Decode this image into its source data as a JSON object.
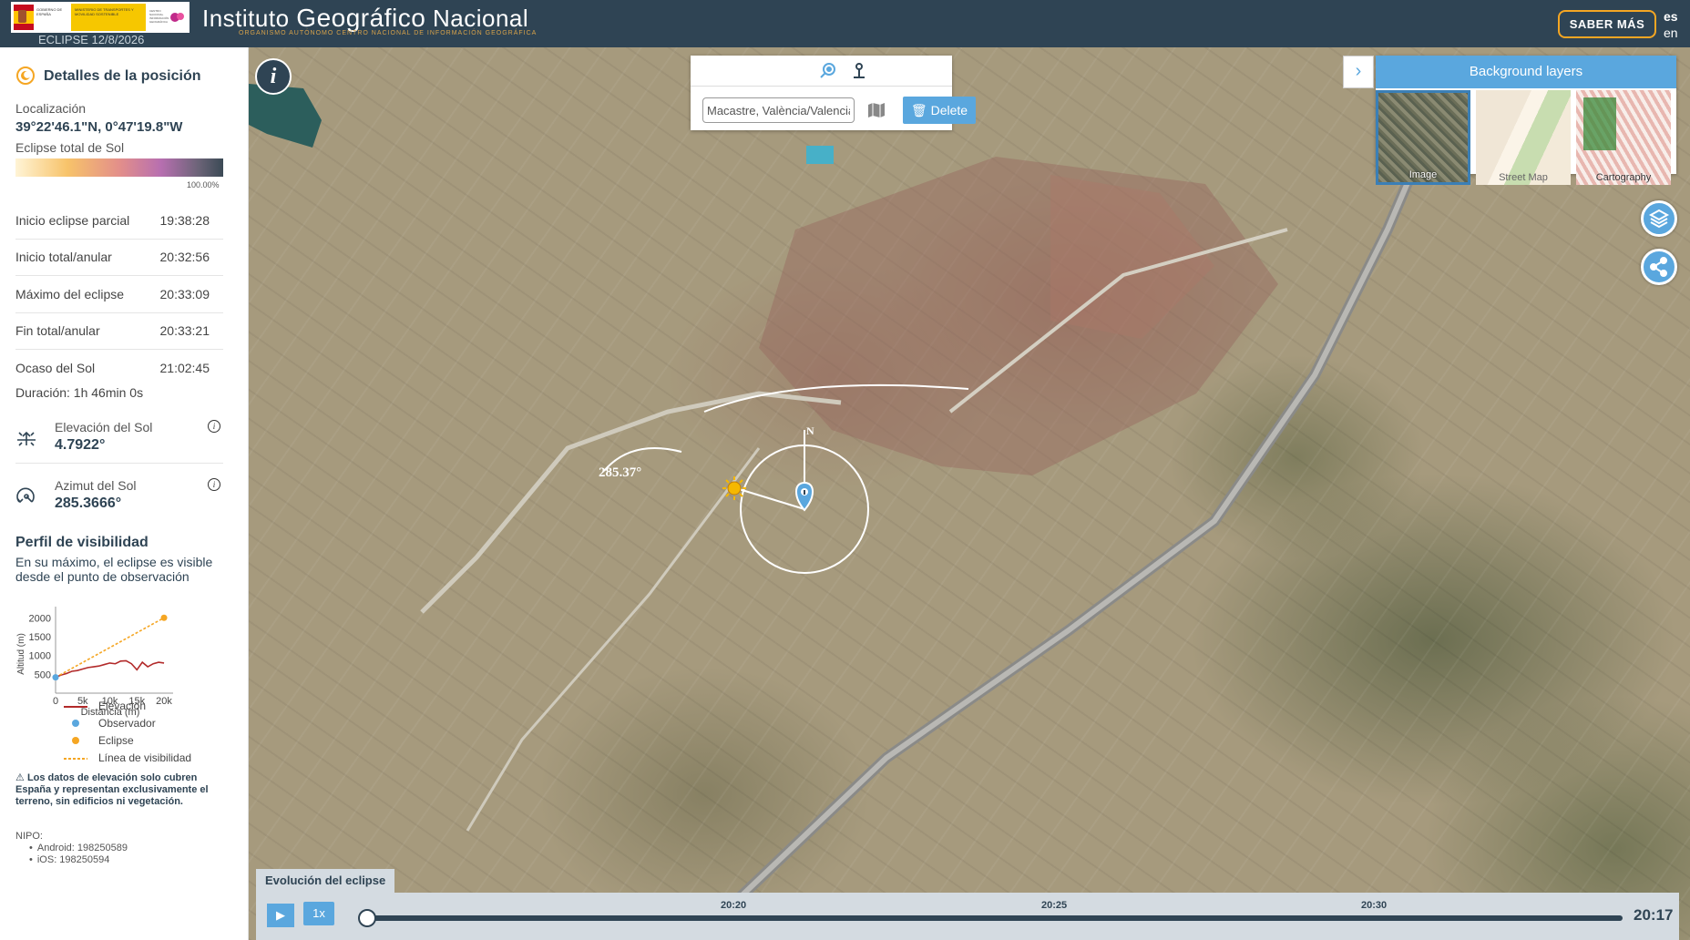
{
  "header": {
    "gov_line": "GOBIERNO DE ESPAÑA",
    "ministry_line": "MINISTERIO DE TRANSPORTES Y MOVILIDAD SOSTENIBLE",
    "cnig_line": "CENTRO NACIONAL INFORMACIÓN GEOGRÁFICA",
    "brand_word1": "Instituto",
    "brand_word2": "Geográfico",
    "brand_word3": "Nacional",
    "brand_sub": "Organismo Autónomo Centro Nacional de Información Geográfica",
    "eclipse_date": "ECLIPSE 12/8/2026",
    "saber_mas": "SABER MÁS",
    "lang_es": "es",
    "lang_en": "en"
  },
  "sidebar": {
    "title": "Detalles de la posición",
    "location_label": "Localización",
    "location_value": "39°22'46.1\"N, 0°47'19.8\"W",
    "eclipse_label": "Eclipse total de Sol",
    "eclipse_pct": "100.00%",
    "times": [
      {
        "label": "Inicio eclipse parcial",
        "value": "19:38:28"
      },
      {
        "label": "Inicio total/anular",
        "value": "20:32:56"
      },
      {
        "label": "Máximo del eclipse",
        "value": "20:33:09"
      },
      {
        "label": "Fin total/anular",
        "value": "20:33:21"
      },
      {
        "label": "Ocaso del Sol",
        "value": "21:02:45"
      }
    ],
    "duration": "Duración: 1h 46min 0s",
    "elevation_label": "Elevación del Sol",
    "elevation_value": "4.7922°",
    "azimuth_label": "Azimut del Sol",
    "azimuth_value": "285.3666°",
    "info_glyph": "i",
    "visibility_title": "Perfil de visibilidad",
    "visibility_desc": "En su máximo, el eclipse es visible desde el punto de observación",
    "disclaimer": "Los datos de elevación solo cubren España y representan exclusivamente el terreno, sin edificios ni vegetación.",
    "nipo_label": "NIPO:",
    "nipo_android": "Android: 198250589",
    "nipo_ios": "iOS: 198250594"
  },
  "chart_data": {
    "type": "line",
    "xlabel": "Distancia (m)",
    "ylabel": "Altitud (m)",
    "xlim": [
      0,
      21000
    ],
    "ylim": [
      0,
      2200
    ],
    "xticks": [
      {
        "v": 0,
        "t": "0"
      },
      {
        "v": 5000,
        "t": "5k"
      },
      {
        "v": 10000,
        "t": "10k"
      },
      {
        "v": 15000,
        "t": "15k"
      },
      {
        "v": 20000,
        "t": "20k"
      }
    ],
    "yticks": [
      {
        "v": 500,
        "t": "500"
      },
      {
        "v": 1000,
        "t": "1000"
      },
      {
        "v": 1500,
        "t": "1500"
      },
      {
        "v": 2000,
        "t": "2000"
      }
    ],
    "series": [
      {
        "name": "Elevación",
        "color": "#b22a2a",
        "x": [
          0,
          1000,
          2000,
          3000,
          4000,
          5000,
          6000,
          7000,
          8000,
          9000,
          10000,
          11000,
          12000,
          13000,
          14000,
          15000,
          16000,
          17000,
          18000,
          19000,
          20000
        ],
        "y": [
          420,
          480,
          520,
          580,
          600,
          640,
          680,
          700,
          720,
          760,
          800,
          780,
          850,
          860,
          780,
          620,
          820,
          700,
          780,
          820,
          800
        ]
      },
      {
        "name": "Línea de visibilidad",
        "color": "#f5a623",
        "dashed": true,
        "x": [
          0,
          20000
        ],
        "y": [
          420,
          2000
        ]
      }
    ],
    "points": [
      {
        "name": "Observador",
        "color": "#5aa7de",
        "x": 0,
        "y": 420
      },
      {
        "name": "Eclipse",
        "color": "#f5a623",
        "x": 20000,
        "y": 2000
      }
    ],
    "legend": [
      {
        "label": "Elevación",
        "kind": "line",
        "color": "#b22a2a"
      },
      {
        "label": "Observador",
        "kind": "dot",
        "color": "#5aa7de"
      },
      {
        "label": "Eclipse",
        "kind": "dot",
        "color": "#f5a623"
      },
      {
        "label": "Línea de visibilidad",
        "kind": "dashed",
        "color": "#f5a623"
      }
    ]
  },
  "map": {
    "info_glyph": "i",
    "search_value": "Macastre, València/Valencia",
    "delete_label": "Delete",
    "azimuth_label": "285.37°",
    "north_label": "N",
    "layers_title": "Background layers",
    "layers_chevron": "›",
    "layers": [
      "Image",
      "Street Map",
      "Cartography"
    ],
    "timeline_title": "Evolución del eclipse",
    "play_glyph": "▶",
    "speed": "1x",
    "ticks": [
      "20:20",
      "20:25",
      "20:30"
    ],
    "current_time": "20:17",
    "accent": "#5aa7de",
    "header_color": "#2f4454",
    "highlight": "#f5a623"
  }
}
